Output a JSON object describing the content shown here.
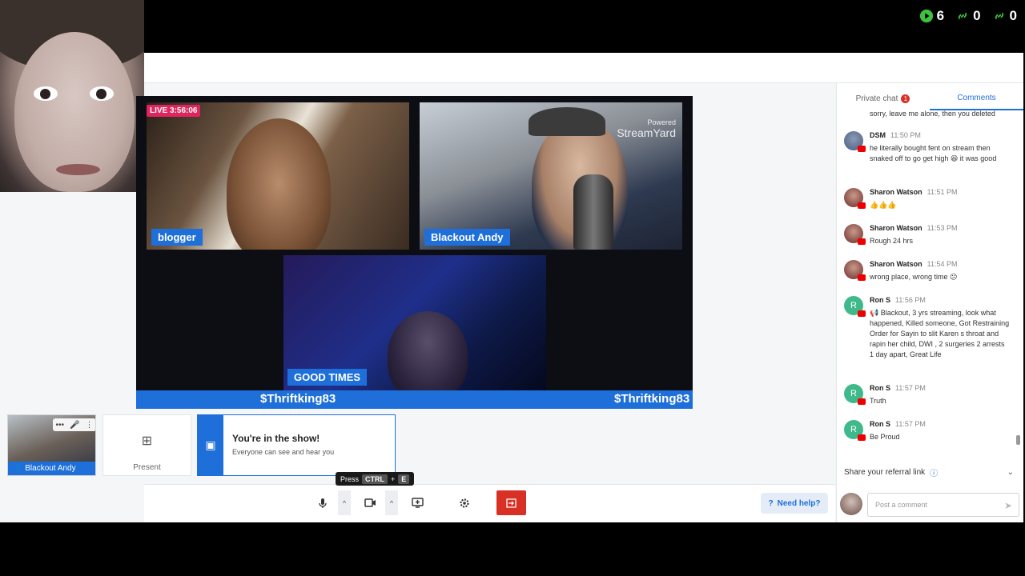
{
  "counters": [
    {
      "icon": "play-icon",
      "value": "6"
    },
    {
      "icon": "link-icon",
      "value": "0"
    },
    {
      "icon": "link-icon",
      "value": "0"
    }
  ],
  "stage": {
    "live_badge": "LIVE 3:56:06",
    "tiles": [
      {
        "name": "blogger"
      },
      {
        "name": "Blackout Andy"
      },
      {
        "name": "GOOD TIMES"
      }
    ],
    "watermark": {
      "top": "Powered",
      "brand": "StreamYard"
    },
    "banner_left": "$Thriftking83",
    "banner_right": "$Thriftking83"
  },
  "host_thumb": {
    "name": "Blackout Andy"
  },
  "present": {
    "label": "Present"
  },
  "in_show": {
    "title": "You're in the show!",
    "subtitle": "Everyone can see and hear you"
  },
  "tooltip": {
    "prefix": "Press",
    "key1": "CTRL",
    "plus": "+",
    "key2": "E"
  },
  "toolbar": {
    "help_label": "Need help?"
  },
  "chat": {
    "tabs": [
      {
        "label": "Private chat",
        "badge": "1",
        "active": false
      },
      {
        "label": "Comments",
        "active": true
      }
    ],
    "previous_line": "sorry, leave me alone, then you deleted",
    "messages": [
      {
        "author": "DSM",
        "time": "11:50 PM",
        "text": "he literally bought fent on stream then snaked off to go get high 😆 it was good",
        "avatar_color": "#4a5a7a"
      },
      {
        "author": "Sharon Watson",
        "time": "11:51 PM",
        "text": "👍👍👍",
        "avatar_color": "#6b2a2a"
      },
      {
        "author": "Sharon Watson",
        "time": "11:53 PM",
        "text": "Rough 24 hrs",
        "avatar_color": "#6b2a2a"
      },
      {
        "author": "Sharon Watson",
        "time": "11:54 PM",
        "text": "wrong place, wrong time 😕",
        "avatar_color": "#6b2a2a"
      },
      {
        "author": "Ron S",
        "time": "11:56 PM",
        "text": "📢 Blackout, 3 yrs streaming, look what happened, Killed someone, Got Restraining Order for Sayin to slit Karen s throat and rapin her child, DWI , 2 surgeries 2 arrests 1 day apart, Great Life",
        "avatar_color": "#3fb98a",
        "initial": "R"
      },
      {
        "author": "Ron S",
        "time": "11:57 PM",
        "text": "Truth",
        "avatar_color": "#3fb98a",
        "initial": "R"
      },
      {
        "author": "Ron S",
        "time": "11:57 PM",
        "text": "Be Proud",
        "avatar_color": "#3fb98a",
        "initial": "R"
      }
    ],
    "referral": "Share your referral link",
    "composer_placeholder": "Post a comment"
  },
  "colors": {
    "accent": "#1e6fd9",
    "leave": "#d93025",
    "live": "#e0245e"
  }
}
